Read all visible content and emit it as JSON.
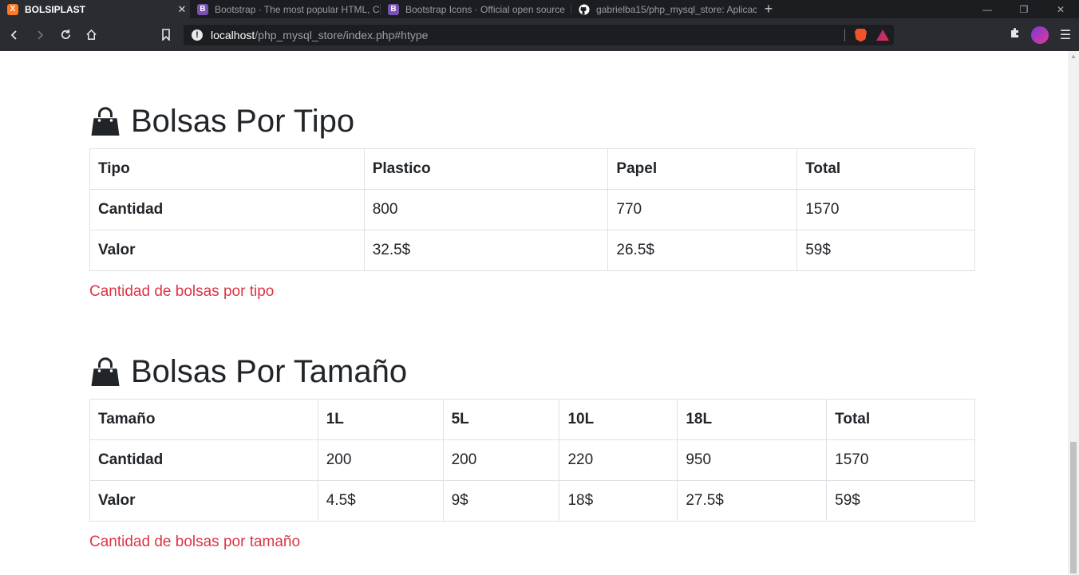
{
  "browser": {
    "tabs": [
      {
        "title": "BOLSIPLAST",
        "favicon": "xampp-icon",
        "favicon_color": "#fb7a24",
        "active": true
      },
      {
        "title": "Bootstrap · The most popular HTML, C",
        "favicon": "bootstrap-icon",
        "favicon_color": "#7952b3",
        "active": false
      },
      {
        "title": "Bootstrap Icons · Official open source",
        "favicon": "bootstrap-icon",
        "favicon_color": "#7952b3",
        "active": false
      },
      {
        "title": "gabrielba15/php_mysql_store: Aplicac",
        "favicon": "github-icon",
        "favicon_color": "#ffffff",
        "active": false
      }
    ],
    "url": {
      "host": "localhost",
      "path": "/php_mysql_store/index.php#htype"
    }
  },
  "sections": [
    {
      "title": "Bolsas Por Tipo",
      "icon": "handbag-icon",
      "rows": [
        [
          "Tipo",
          "Plastico",
          "Papel",
          "Total"
        ],
        [
          "Cantidad",
          "800",
          "770",
          "1570"
        ],
        [
          "Valor",
          "32.5$",
          "26.5$",
          "59$"
        ]
      ],
      "caption": "Cantidad de bolsas por tipo"
    },
    {
      "title": "Bolsas Por Tamaño",
      "icon": "handbag-icon",
      "rows": [
        [
          "Tamaño",
          "1L",
          "5L",
          "10L",
          "18L",
          "Total"
        ],
        [
          "Cantidad",
          "200",
          "200",
          "220",
          "950",
          "1570"
        ],
        [
          "Valor",
          "4.5$",
          "9$",
          "18$",
          "27.5$",
          "59$"
        ]
      ],
      "caption": "Cantidad de bolsas por tamaño"
    }
  ],
  "colors": {
    "caption": "#dc3545",
    "text": "#212529",
    "border": "#dee2e6"
  }
}
